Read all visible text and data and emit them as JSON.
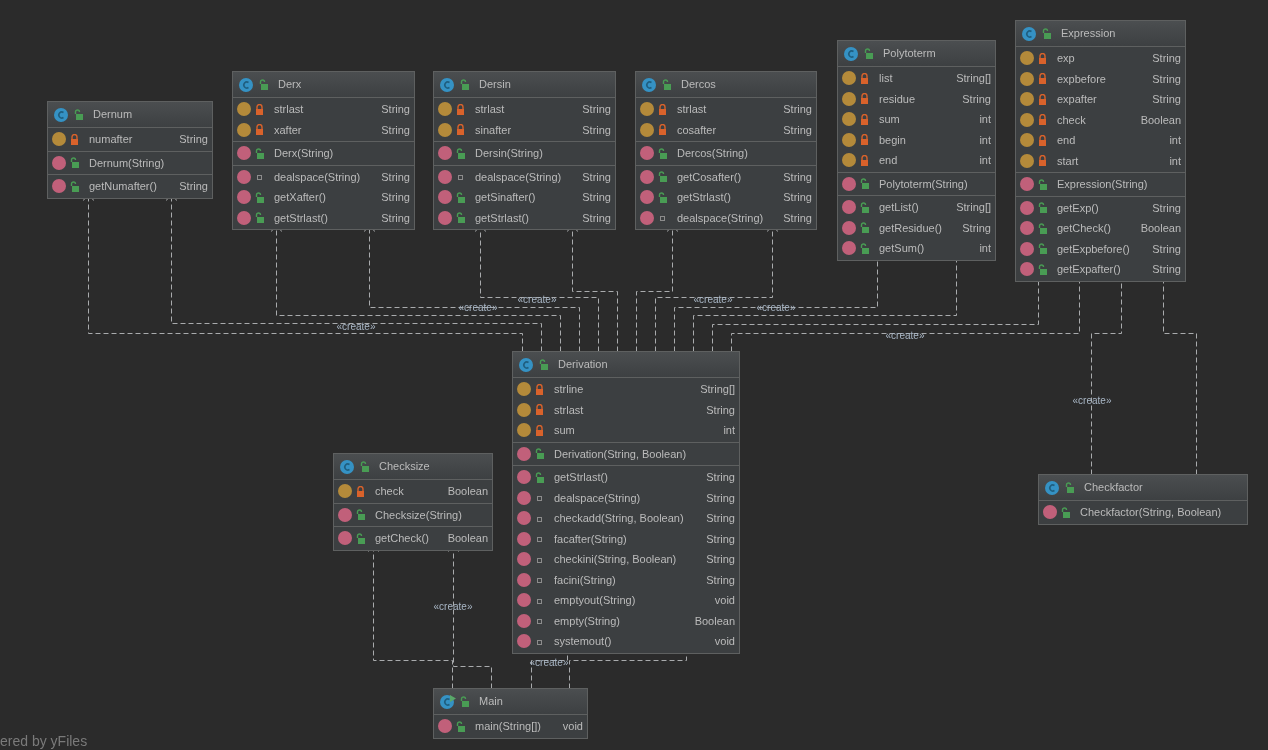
{
  "diagram": {
    "classes": [
      {
        "name": "Dernum",
        "kind": "class",
        "fields": [
          {
            "kind": "private",
            "name": "numafter",
            "type": "String"
          }
        ],
        "constructors": [
          {
            "kind": "public",
            "name": "Dernum(String)"
          }
        ],
        "methods": [
          {
            "kind": "public",
            "name": "getNumafter()",
            "type": "String"
          }
        ]
      },
      {
        "name": "Derx",
        "kind": "class",
        "fields": [
          {
            "kind": "private",
            "name": "strlast",
            "type": "String"
          },
          {
            "kind": "private",
            "name": "xafter",
            "type": "String"
          }
        ],
        "constructors": [
          {
            "kind": "public",
            "name": "Derx(String)"
          }
        ],
        "methods": [
          {
            "kind": "package",
            "name": "dealspace(String)",
            "type": "String"
          },
          {
            "kind": "public",
            "name": "getXafter()",
            "type": "String"
          },
          {
            "kind": "public",
            "name": "getStrlast()",
            "type": "String"
          }
        ]
      },
      {
        "name": "Dersin",
        "kind": "class",
        "fields": [
          {
            "kind": "private",
            "name": "strlast",
            "type": "String"
          },
          {
            "kind": "private",
            "name": "sinafter",
            "type": "String"
          }
        ],
        "constructors": [
          {
            "kind": "public",
            "name": "Dersin(String)"
          }
        ],
        "methods": [
          {
            "kind": "package",
            "name": "dealspace(String)",
            "type": "String"
          },
          {
            "kind": "public",
            "name": "getSinafter()",
            "type": "String"
          },
          {
            "kind": "public",
            "name": "getStrlast()",
            "type": "String"
          }
        ]
      },
      {
        "name": "Dercos",
        "kind": "class",
        "fields": [
          {
            "kind": "private",
            "name": "strlast",
            "type": "String"
          },
          {
            "kind": "private",
            "name": "cosafter",
            "type": "String"
          }
        ],
        "constructors": [
          {
            "kind": "public",
            "name": "Dercos(String)"
          }
        ],
        "methods": [
          {
            "kind": "public",
            "name": "getCosafter()",
            "type": "String"
          },
          {
            "kind": "public",
            "name": "getStrlast()",
            "type": "String"
          },
          {
            "kind": "package",
            "name": "dealspace(String)",
            "type": "String"
          }
        ]
      },
      {
        "name": "Polytoterm",
        "kind": "class",
        "fields": [
          {
            "kind": "private",
            "name": "list",
            "type": "String[]"
          },
          {
            "kind": "private",
            "name": "residue",
            "type": "String"
          },
          {
            "kind": "private",
            "name": "sum",
            "type": "int"
          },
          {
            "kind": "private",
            "name": "begin",
            "type": "int"
          },
          {
            "kind": "private",
            "name": "end",
            "type": "int"
          }
        ],
        "constructors": [
          {
            "kind": "public",
            "name": "Polytoterm(String)"
          }
        ],
        "methods": [
          {
            "kind": "public",
            "name": "getList()",
            "type": "String[]"
          },
          {
            "kind": "public",
            "name": "getResidue()",
            "type": "String"
          },
          {
            "kind": "public",
            "name": "getSum()",
            "type": "int"
          }
        ]
      },
      {
        "name": "Expression",
        "kind": "class",
        "fields": [
          {
            "kind": "private",
            "name": "exp",
            "type": "String"
          },
          {
            "kind": "private",
            "name": "expbefore",
            "type": "String"
          },
          {
            "kind": "private",
            "name": "expafter",
            "type": "String"
          },
          {
            "kind": "private",
            "name": "check",
            "type": "Boolean"
          },
          {
            "kind": "private",
            "name": "end",
            "type": "int"
          },
          {
            "kind": "private",
            "name": "start",
            "type": "int"
          }
        ],
        "constructors": [
          {
            "kind": "public",
            "name": "Expression(String)"
          }
        ],
        "methods": [
          {
            "kind": "public",
            "name": "getExp()",
            "type": "String"
          },
          {
            "kind": "public",
            "name": "getCheck()",
            "type": "Boolean"
          },
          {
            "kind": "public",
            "name": "getExpbefore()",
            "type": "String"
          },
          {
            "kind": "public",
            "name": "getExpafter()",
            "type": "String"
          }
        ]
      },
      {
        "name": "Checksize",
        "kind": "class",
        "fields": [
          {
            "kind": "private",
            "name": "check",
            "type": "Boolean"
          }
        ],
        "constructors": [
          {
            "kind": "public",
            "name": "Checksize(String)"
          }
        ],
        "methods": [
          {
            "kind": "public",
            "name": "getCheck()",
            "type": "Boolean"
          }
        ]
      },
      {
        "name": "Derivation",
        "kind": "class",
        "fields": [
          {
            "kind": "private",
            "name": "strline",
            "type": "String[]"
          },
          {
            "kind": "private",
            "name": "strlast",
            "type": "String"
          },
          {
            "kind": "private",
            "name": "sum",
            "type": "int"
          }
        ],
        "constructors": [
          {
            "kind": "public",
            "name": "Derivation(String, Boolean)"
          }
        ],
        "methods": [
          {
            "kind": "public",
            "name": "getStrlast()",
            "type": "String"
          },
          {
            "kind": "package",
            "name": "dealspace(String)",
            "type": "String"
          },
          {
            "kind": "package",
            "name": "checkadd(String, Boolean)",
            "type": "String"
          },
          {
            "kind": "package",
            "name": "facafter(String)",
            "type": "String"
          },
          {
            "kind": "package",
            "name": "checkini(String, Boolean)",
            "type": "String"
          },
          {
            "kind": "package",
            "name": "facini(String)",
            "type": "String"
          },
          {
            "kind": "package",
            "name": "emptyout(String)",
            "type": "void"
          },
          {
            "kind": "package",
            "name": "empty(String)",
            "type": "Boolean"
          },
          {
            "kind": "package",
            "name": "systemout()",
            "type": "void"
          }
        ]
      },
      {
        "name": "Checkfactor",
        "kind": "class",
        "constructors": [
          {
            "kind": "public",
            "name": "Checkfactor(String, Boolean)"
          }
        ]
      },
      {
        "name": "Main",
        "kind": "main",
        "methods": [
          {
            "kind": "public",
            "name": "main(String[])",
            "type": "void"
          }
        ]
      }
    ],
    "connectors": [
      {
        "kind": "dependency"
      },
      {
        "kind": "dependency",
        "label": "«create»"
      },
      {
        "kind": "dependency"
      },
      {
        "kind": "dependency",
        "label": "«create»"
      },
      {
        "kind": "dependency",
        "label": "«create»"
      },
      {
        "kind": "dependency"
      },
      {
        "kind": "dependency"
      },
      {
        "kind": "dependency",
        "label": "«create»"
      },
      {
        "kind": "dependency",
        "label": "«create»"
      },
      {
        "kind": "dependency"
      },
      {
        "kind": "dependency"
      },
      {
        "kind": "dependency",
        "label": "«create»"
      },
      {
        "kind": "dependency",
        "label": "«create»"
      },
      {
        "kind": "dependency"
      },
      {
        "kind": "dependency"
      },
      {
        "kind": "dependency",
        "label": "«create»"
      },
      {
        "kind": "dependency",
        "label": "«create»"
      },
      {
        "kind": "dependency"
      }
    ]
  },
  "footer_text": "ered by yFiles"
}
